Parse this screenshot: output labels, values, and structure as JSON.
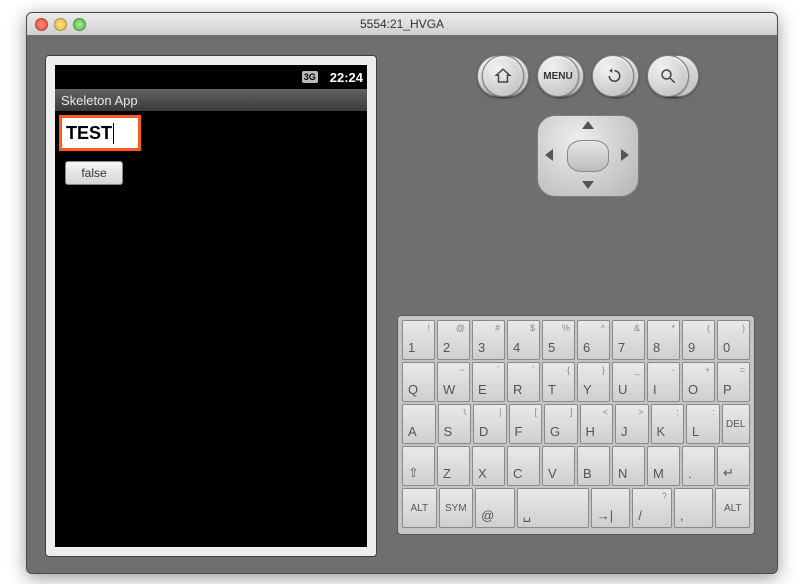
{
  "window": {
    "title": "5554:21_HVGA"
  },
  "phone": {
    "status": {
      "network_icon": "3G",
      "signal_icon": "signal",
      "battery_icon": "battery",
      "time": "22:24"
    },
    "app_title": "Skeleton App",
    "input_value": "TEST",
    "button_label": "false"
  },
  "controls": {
    "camera": "camera-icon",
    "vol_down": "volume-down-icon",
    "vol_up": "volume-up-icon",
    "power": "power-icon",
    "call": "phone-call-icon",
    "end": "phone-end-icon",
    "home": "home-icon",
    "menu_label": "MENU",
    "back": "back-icon",
    "search": "search-icon"
  },
  "keyboard": {
    "row1": [
      {
        "main": "1",
        "sup": "!"
      },
      {
        "main": "2",
        "sup": "@"
      },
      {
        "main": "3",
        "sup": "#"
      },
      {
        "main": "4",
        "sup": "$"
      },
      {
        "main": "5",
        "sup": "%"
      },
      {
        "main": "6",
        "sup": "^"
      },
      {
        "main": "7",
        "sup": "&"
      },
      {
        "main": "8",
        "sup": "*"
      },
      {
        "main": "9",
        "sup": "("
      },
      {
        "main": "0",
        "sup": ")"
      }
    ],
    "row2": [
      {
        "main": "Q"
      },
      {
        "main": "W",
        "sup": "~"
      },
      {
        "main": "E",
        "sup": "´"
      },
      {
        "main": "R",
        "sup": "`"
      },
      {
        "main": "T",
        "sup": "{"
      },
      {
        "main": "Y",
        "sup": "}"
      },
      {
        "main": "U",
        "sup": "_"
      },
      {
        "main": "I",
        "sup": "-"
      },
      {
        "main": "O",
        "sup": "+"
      },
      {
        "main": "P",
        "sup": "="
      }
    ],
    "row3": [
      {
        "main": "A"
      },
      {
        "main": "S",
        "sup": "\\"
      },
      {
        "main": "D",
        "sup": "|"
      },
      {
        "main": "F",
        "sup": "["
      },
      {
        "main": "G",
        "sup": "]"
      },
      {
        "main": "H",
        "sup": "<"
      },
      {
        "main": "J",
        "sup": ">"
      },
      {
        "main": "K",
        "sup": ";"
      },
      {
        "main": "L",
        "sup": ":"
      },
      {
        "main": "DEL",
        "sup": ""
      }
    ],
    "row4": [
      {
        "main": "⇧"
      },
      {
        "main": "Z"
      },
      {
        "main": "X"
      },
      {
        "main": "C"
      },
      {
        "main": "V"
      },
      {
        "main": "B"
      },
      {
        "main": "N"
      },
      {
        "main": "M"
      },
      {
        "main": "."
      },
      {
        "main": "↵"
      }
    ],
    "row5": [
      {
        "main": "ALT"
      },
      {
        "main": "SYM"
      },
      {
        "main": "@"
      },
      {
        "main": "␣",
        "wide": true
      },
      {
        "main": "→|"
      },
      {
        "main": "/",
        "sup": "?"
      },
      {
        "main": ",",
        "sup": ""
      },
      {
        "main": "ALT"
      }
    ]
  }
}
